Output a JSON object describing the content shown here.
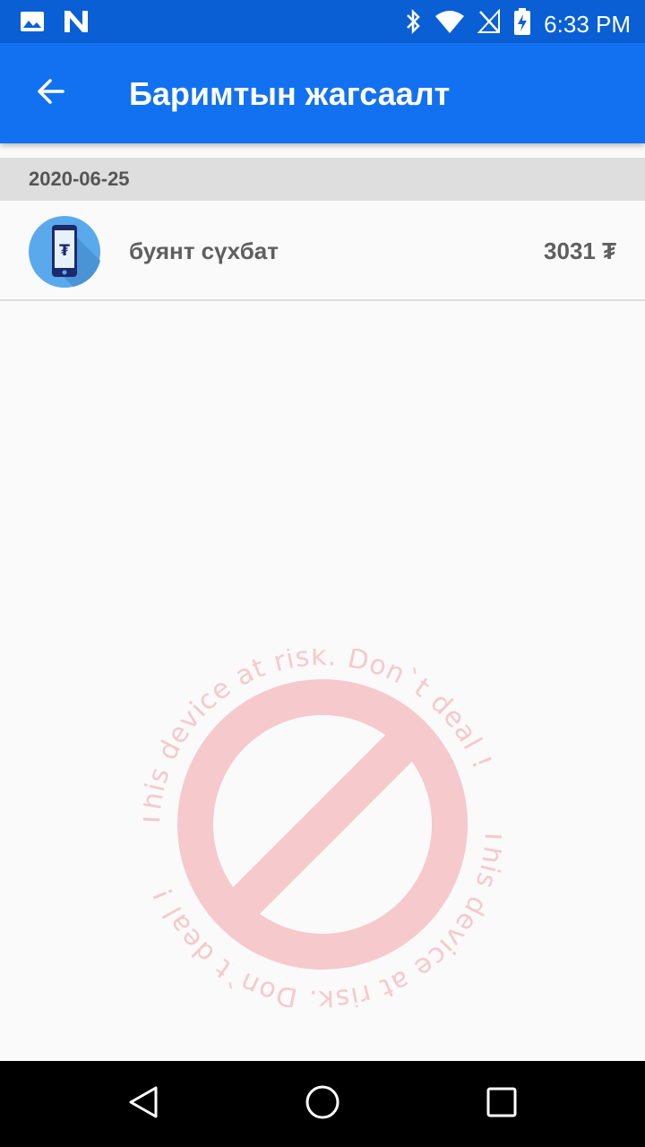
{
  "status_bar": {
    "time": "6:33 PM",
    "left_icons": [
      "image-icon",
      "n-icon"
    ],
    "right_icons": [
      "bluetooth-icon",
      "wifi-icon",
      "no-signal-icon",
      "battery-charging-icon"
    ]
  },
  "app_bar": {
    "title": "Баримтын жагсаалт",
    "back_icon": "arrow-left-icon",
    "color": "#1171f0"
  },
  "list": {
    "sections": [
      {
        "date": "2020-06-25",
        "items": [
          {
            "name": "буянт сүхбат",
            "amount": "3031 ₮",
            "icon": "phone-tugrik-icon",
            "icon_symbol": "₮"
          }
        ]
      }
    ]
  },
  "watermark": {
    "text": "This device at risk. Don`t deal !",
    "color": "#f6c9cc"
  },
  "nav_bar": {
    "buttons": [
      "back-triangle-icon",
      "home-circle-icon",
      "recents-square-icon"
    ]
  }
}
